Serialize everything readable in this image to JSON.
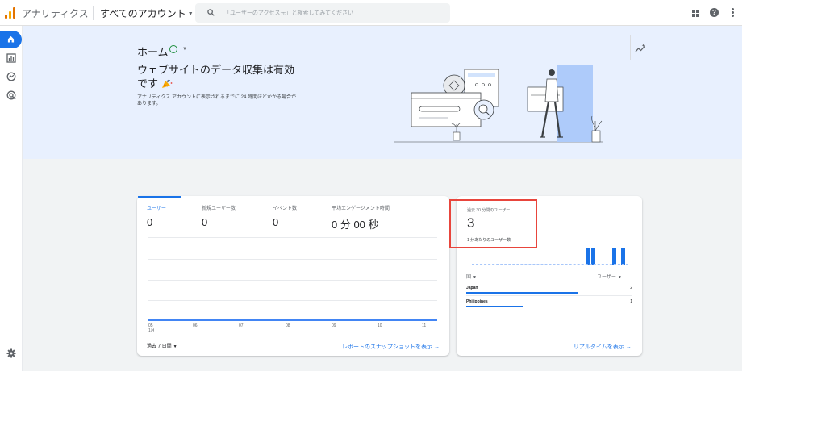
{
  "topbar": {
    "app_title": "アナリティクス",
    "account": "すべてのアカウント",
    "search_placeholder": "「ユーザーのアクセス元」と検索してみてください"
  },
  "nav": {
    "items": [
      {
        "name": "home-icon",
        "active": true
      },
      {
        "name": "reports-icon",
        "active": false
      },
      {
        "name": "explore-icon",
        "active": false
      },
      {
        "name": "advertising-icon",
        "active": false
      }
    ],
    "settings_icon": "gear-icon"
  },
  "hero": {
    "title": "ホーム",
    "headline": "ウェブサイトのデータ収集は有効です",
    "subtext": "アナリティクス アカウントに表示されるまでに 24 時間ほどかかる場合があります。"
  },
  "metrics": {
    "tabs": [
      {
        "label": "ユーザー",
        "value": "0",
        "active": true
      },
      {
        "label": "新規ユーザー数",
        "value": "0",
        "active": false
      },
      {
        "label": "イベント数",
        "value": "0",
        "active": false
      },
      {
        "label": "平均エンゲージメント時間",
        "value": "0 分 00 秒",
        "active": false
      }
    ],
    "x_ticks": [
      {
        "day": "05",
        "month": "1月"
      },
      {
        "day": "06",
        "month": ""
      },
      {
        "day": "07",
        "month": ""
      },
      {
        "day": "08",
        "month": ""
      },
      {
        "day": "09",
        "month": ""
      },
      {
        "day": "10",
        "month": ""
      },
      {
        "day": "11",
        "month": ""
      }
    ],
    "date_range": "過去 7 日間",
    "snapshot_link": "レポートのスナップショットを表示 →"
  },
  "realtime": {
    "title": "過去 30 分間のユーザー",
    "value": "3",
    "subtitle": "1 分あたりのユーザー数",
    "col_country": "国",
    "col_users": "ユーザー",
    "rows": [
      {
        "country": "Japan",
        "users": "2",
        "fraction": 0.67
      },
      {
        "country": "Philippines",
        "users": "1",
        "fraction": 0.34
      }
    ],
    "link": "リアルタイムを表示 →"
  },
  "colors": {
    "accent": "#1a73e8",
    "banner": "#e8f0fe",
    "highlight": "#e8453c"
  }
}
